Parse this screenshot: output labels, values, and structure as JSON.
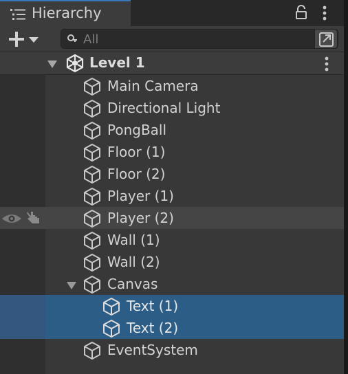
{
  "window": {
    "tab_title": "Hierarchy",
    "tab_icon": "hierarchy-list-icon",
    "lock_icon": "lock-icon",
    "menu_icon": "kebab-menu-icon"
  },
  "toolbar": {
    "add_icon": "plus-icon",
    "dropdown_icon": "chevron-down-icon",
    "search_placeholder": "All",
    "search_value": "",
    "search_mode_icon": "search-mode-icon"
  },
  "scene": {
    "name": "Level 1",
    "icon": "unity-logo-icon",
    "expanded": true,
    "menu_icon": "kebab-menu-icon"
  },
  "items": [
    {
      "label": "Main Camera",
      "depth": 0
    },
    {
      "label": "Directional Light",
      "depth": 0
    },
    {
      "label": "PongBall",
      "depth": 0
    },
    {
      "label": "Floor (1)",
      "depth": 0
    },
    {
      "label": "Floor (2)",
      "depth": 0
    },
    {
      "label": "Player (1)",
      "depth": 0
    },
    {
      "label": "Player (2)",
      "depth": 0,
      "hovered": true
    },
    {
      "label": "Wall (1)",
      "depth": 0
    },
    {
      "label": "Wall (2)",
      "depth": 0
    },
    {
      "label": "Canvas",
      "depth": 0,
      "expanded": true
    },
    {
      "label": "Text (1)",
      "depth": 1,
      "selected": true
    },
    {
      "label": "Text (2)",
      "depth": 1,
      "selected": true
    },
    {
      "label": "EventSystem",
      "depth": 0
    }
  ],
  "gutter_icons": {
    "visibility": "eye-icon",
    "pickability": "hand-pointer-icon"
  },
  "colors": {
    "selection": "#2c5d87",
    "hover": "#454545",
    "panel": "#383838",
    "tab_accent": "#3a79bb"
  }
}
